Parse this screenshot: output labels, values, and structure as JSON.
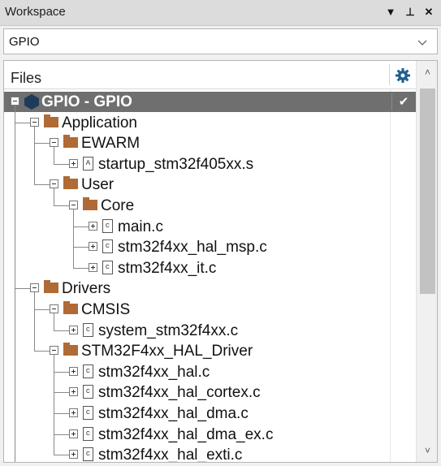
{
  "window": {
    "title": "Workspace",
    "controls": [
      "▼",
      "⊥",
      "✕"
    ]
  },
  "config_select": {
    "value": "GPIO"
  },
  "files_panel": {
    "header": "Files",
    "checkmark": "✔",
    "tree": [
      {
        "label": "GPIO - GPIO",
        "kind": "project"
      },
      {
        "label": "Application",
        "kind": "folder"
      },
      {
        "label": "EWARM",
        "kind": "folder"
      },
      {
        "label": "startup_stm32f405xx.s",
        "kind": "file",
        "glyph": "A"
      },
      {
        "label": "User",
        "kind": "folder"
      },
      {
        "label": "Core",
        "kind": "folder"
      },
      {
        "label": "main.c",
        "kind": "file",
        "glyph": "c"
      },
      {
        "label": "stm32f4xx_hal_msp.c",
        "kind": "file",
        "glyph": "c"
      },
      {
        "label": "stm32f4xx_it.c",
        "kind": "file",
        "glyph": "c"
      },
      {
        "label": "Drivers",
        "kind": "folder"
      },
      {
        "label": "CMSIS",
        "kind": "folder"
      },
      {
        "label": "system_stm32f4xx.c",
        "kind": "file",
        "glyph": "c"
      },
      {
        "label": "STM32F4xx_HAL_Driver",
        "kind": "folder"
      },
      {
        "label": "stm32f4xx_hal.c",
        "kind": "file",
        "glyph": "c"
      },
      {
        "label": "stm32f4xx_hal_cortex.c",
        "kind": "file",
        "glyph": "c"
      },
      {
        "label": "stm32f4xx_hal_dma.c",
        "kind": "file",
        "glyph": "c"
      },
      {
        "label": "stm32f4xx_hal_dma_ex.c",
        "kind": "file",
        "glyph": "c"
      },
      {
        "label": "stm32f4xx_hal_exti.c",
        "kind": "file",
        "glyph": "c"
      }
    ]
  },
  "scrollbar": {
    "up": "˄",
    "down": "˅"
  },
  "colors": {
    "selection": "#6f6f6f",
    "folder": "#b06a35",
    "project_icon": "#1f3b5a",
    "gear": "#1f5f8f"
  }
}
